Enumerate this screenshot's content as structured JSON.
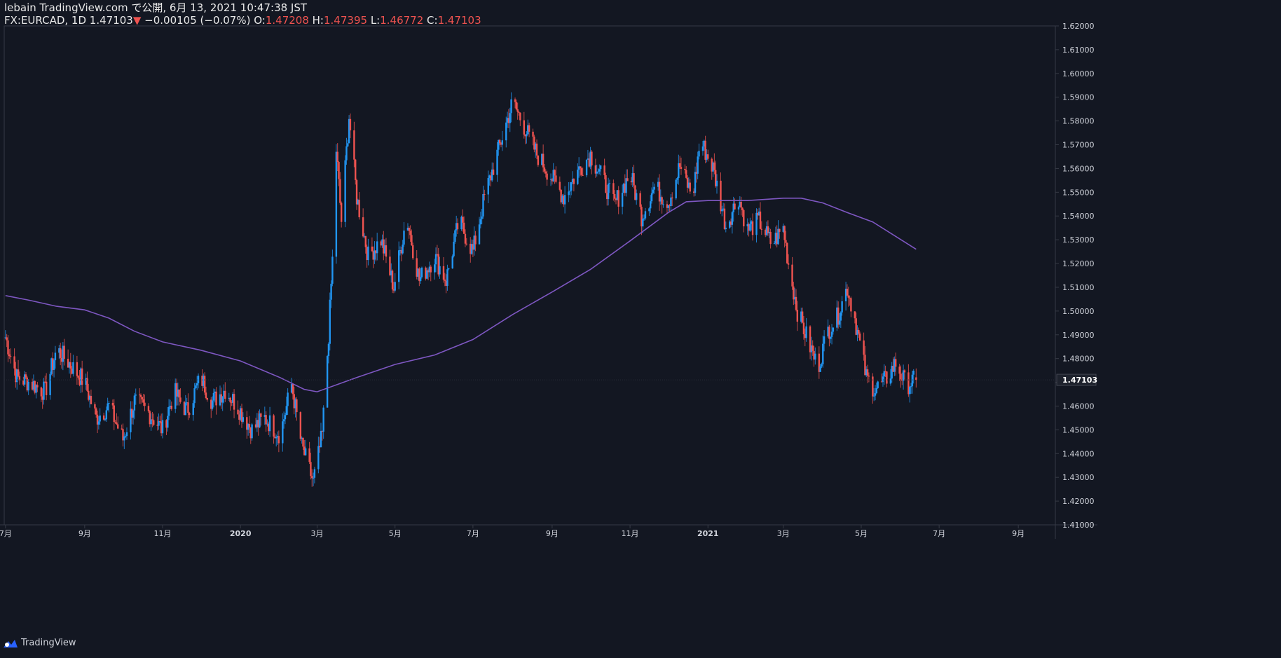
{
  "header": {
    "line1": "lebain TradingView.com で公開, 6月 13, 2021 10:47:38 JST",
    "symbol": "FX:EURCAD, 1D",
    "last": "1.47103",
    "change_arrow": "▼",
    "change": "−0.00105 (−0.07%)",
    "o_label": "O:",
    "o_value": "1.47208",
    "h_label": "H:",
    "h_value": "1.47395",
    "l_label": "L:",
    "l_value": "1.46772",
    "c_label": "C:",
    "c_value": "1.47103"
  },
  "footer": {
    "brand": "TradingView"
  },
  "colors": {
    "background": "#131722",
    "up": "#2196f3",
    "down": "#ef5350",
    "ma": "#7e57c2",
    "grid_border": "#363a45",
    "text": "#d1d4dc"
  },
  "chart_data": {
    "type": "candlestick",
    "symbol": "FX:EURCAD",
    "interval": "1D",
    "ylim": [
      1.41,
      1.62
    ],
    "y_ticks": [
      "1.41000",
      "1.42000",
      "1.43000",
      "1.44000",
      "1.45000",
      "1.46000",
      "1.47000",
      "1.48000",
      "1.49000",
      "1.50000",
      "1.51000",
      "1.52000",
      "1.53000",
      "1.54000",
      "1.55000",
      "1.56000",
      "1.57000",
      "1.58000",
      "1.59000",
      "1.60000",
      "1.61000",
      "1.62000"
    ],
    "x_ticks": [
      "7月",
      "9月",
      "11月",
      "2020",
      "3月",
      "5月",
      "7月",
      "9月",
      "11月",
      "2021",
      "3月",
      "5月",
      "7月",
      "9月"
    ],
    "last_price_label": "1.47103",
    "close_path": [
      [
        "2019-07-01",
        1.489
      ],
      [
        "2019-07-10",
        1.472
      ],
      [
        "2019-07-20",
        1.47
      ],
      [
        "2019-08-01",
        1.466
      ],
      [
        "2019-08-10",
        1.484
      ],
      [
        "2019-08-20",
        1.478
      ],
      [
        "2019-09-01",
        1.47
      ],
      [
        "2019-09-10",
        1.455
      ],
      [
        "2019-09-20",
        1.46
      ],
      [
        "2019-10-01",
        1.446
      ],
      [
        "2019-10-10",
        1.462
      ],
      [
        "2019-10-20",
        1.458
      ],
      [
        "2019-11-01",
        1.45
      ],
      [
        "2019-11-10",
        1.466
      ],
      [
        "2019-11-20",
        1.458
      ],
      [
        "2019-12-01",
        1.472
      ],
      [
        "2019-12-10",
        1.462
      ],
      [
        "2019-12-20",
        1.467
      ],
      [
        "2020-01-01",
        1.458
      ],
      [
        "2020-01-10",
        1.45
      ],
      [
        "2020-01-20",
        1.455
      ],
      [
        "2020-02-01",
        1.448
      ],
      [
        "2020-02-10",
        1.469
      ],
      [
        "2020-02-18",
        1.443
      ],
      [
        "2020-02-27",
        1.428
      ],
      [
        "2020-03-05",
        1.448
      ],
      [
        "2020-03-10",
        1.49
      ],
      [
        "2020-03-14",
        1.532
      ],
      [
        "2020-03-16",
        1.568
      ],
      [
        "2020-03-20",
        1.538
      ],
      [
        "2020-03-26",
        1.582
      ],
      [
        "2020-04-01",
        1.548
      ],
      [
        "2020-04-10",
        1.523
      ],
      [
        "2020-04-20",
        1.53
      ],
      [
        "2020-04-30",
        1.51
      ],
      [
        "2020-05-10",
        1.54
      ],
      [
        "2020-05-20",
        1.513
      ],
      [
        "2020-06-01",
        1.523
      ],
      [
        "2020-06-10",
        1.513
      ],
      [
        "2020-06-20",
        1.538
      ],
      [
        "2020-07-01",
        1.525
      ],
      [
        "2020-07-10",
        1.548
      ],
      [
        "2020-07-20",
        1.566
      ],
      [
        "2020-08-01",
        1.588
      ],
      [
        "2020-08-10",
        1.578
      ],
      [
        "2020-08-20",
        1.566
      ],
      [
        "2020-09-01",
        1.556
      ],
      [
        "2020-09-10",
        1.548
      ],
      [
        "2020-09-20",
        1.558
      ],
      [
        "2020-10-01",
        1.566
      ],
      [
        "2020-10-10",
        1.556
      ],
      [
        "2020-10-20",
        1.545
      ],
      [
        "2020-11-01",
        1.558
      ],
      [
        "2020-11-10",
        1.54
      ],
      [
        "2020-11-20",
        1.552
      ],
      [
        "2020-12-01",
        1.546
      ],
      [
        "2020-12-10",
        1.561
      ],
      [
        "2020-12-20",
        1.548
      ],
      [
        "2020-12-26",
        1.572
      ],
      [
        "2021-01-05",
        1.56
      ],
      [
        "2021-01-15",
        1.536
      ],
      [
        "2021-01-25",
        1.548
      ],
      [
        "2021-02-01",
        1.534
      ],
      [
        "2021-02-10",
        1.538
      ],
      [
        "2021-02-20",
        1.528
      ],
      [
        "2021-03-01",
        1.535
      ],
      [
        "2021-03-05",
        1.52
      ],
      [
        "2021-03-12",
        1.5
      ],
      [
        "2021-03-20",
        1.488
      ],
      [
        "2021-03-28",
        1.476
      ],
      [
        "2021-04-05",
        1.492
      ],
      [
        "2021-04-12",
        1.497
      ],
      [
        "2021-04-20",
        1.51
      ],
      [
        "2021-04-26",
        1.497
      ],
      [
        "2021-05-05",
        1.472
      ],
      [
        "2021-05-12",
        1.467
      ],
      [
        "2021-05-20",
        1.471
      ],
      [
        "2021-05-28",
        1.478
      ],
      [
        "2021-06-05",
        1.469
      ],
      [
        "2021-06-13",
        1.471
      ]
    ],
    "ma_line": [
      [
        "2019-07-01",
        1.5065
      ],
      [
        "2019-07-20",
        1.5045
      ],
      [
        "2019-08-10",
        1.502
      ],
      [
        "2019-09-01",
        1.5005
      ],
      [
        "2019-09-20",
        1.497
      ],
      [
        "2019-10-10",
        1.4915
      ],
      [
        "2019-11-01",
        1.487
      ],
      [
        "2019-12-01",
        1.4835
      ],
      [
        "2020-01-01",
        1.479
      ],
      [
        "2020-02-01",
        1.472
      ],
      [
        "2020-02-20",
        1.467
      ],
      [
        "2020-03-01",
        1.466
      ],
      [
        "2020-04-01",
        1.472
      ],
      [
        "2020-05-01",
        1.4775
      ],
      [
        "2020-06-01",
        1.4815
      ],
      [
        "2020-07-01",
        1.488
      ],
      [
        "2020-08-01",
        1.4985
      ],
      [
        "2020-09-01",
        1.508
      ],
      [
        "2020-10-01",
        1.5175
      ],
      [
        "2020-11-01",
        1.5295
      ],
      [
        "2020-12-01",
        1.5415
      ],
      [
        "2020-12-15",
        1.546
      ],
      [
        "2021-01-01",
        1.5465
      ],
      [
        "2021-02-01",
        1.5465
      ],
      [
        "2021-03-01",
        1.5475
      ],
      [
        "2021-03-15",
        1.5475
      ],
      [
        "2021-04-01",
        1.5455
      ],
      [
        "2021-04-20",
        1.5415
      ],
      [
        "2021-05-10",
        1.5375
      ],
      [
        "2021-06-13",
        1.526
      ]
    ]
  }
}
